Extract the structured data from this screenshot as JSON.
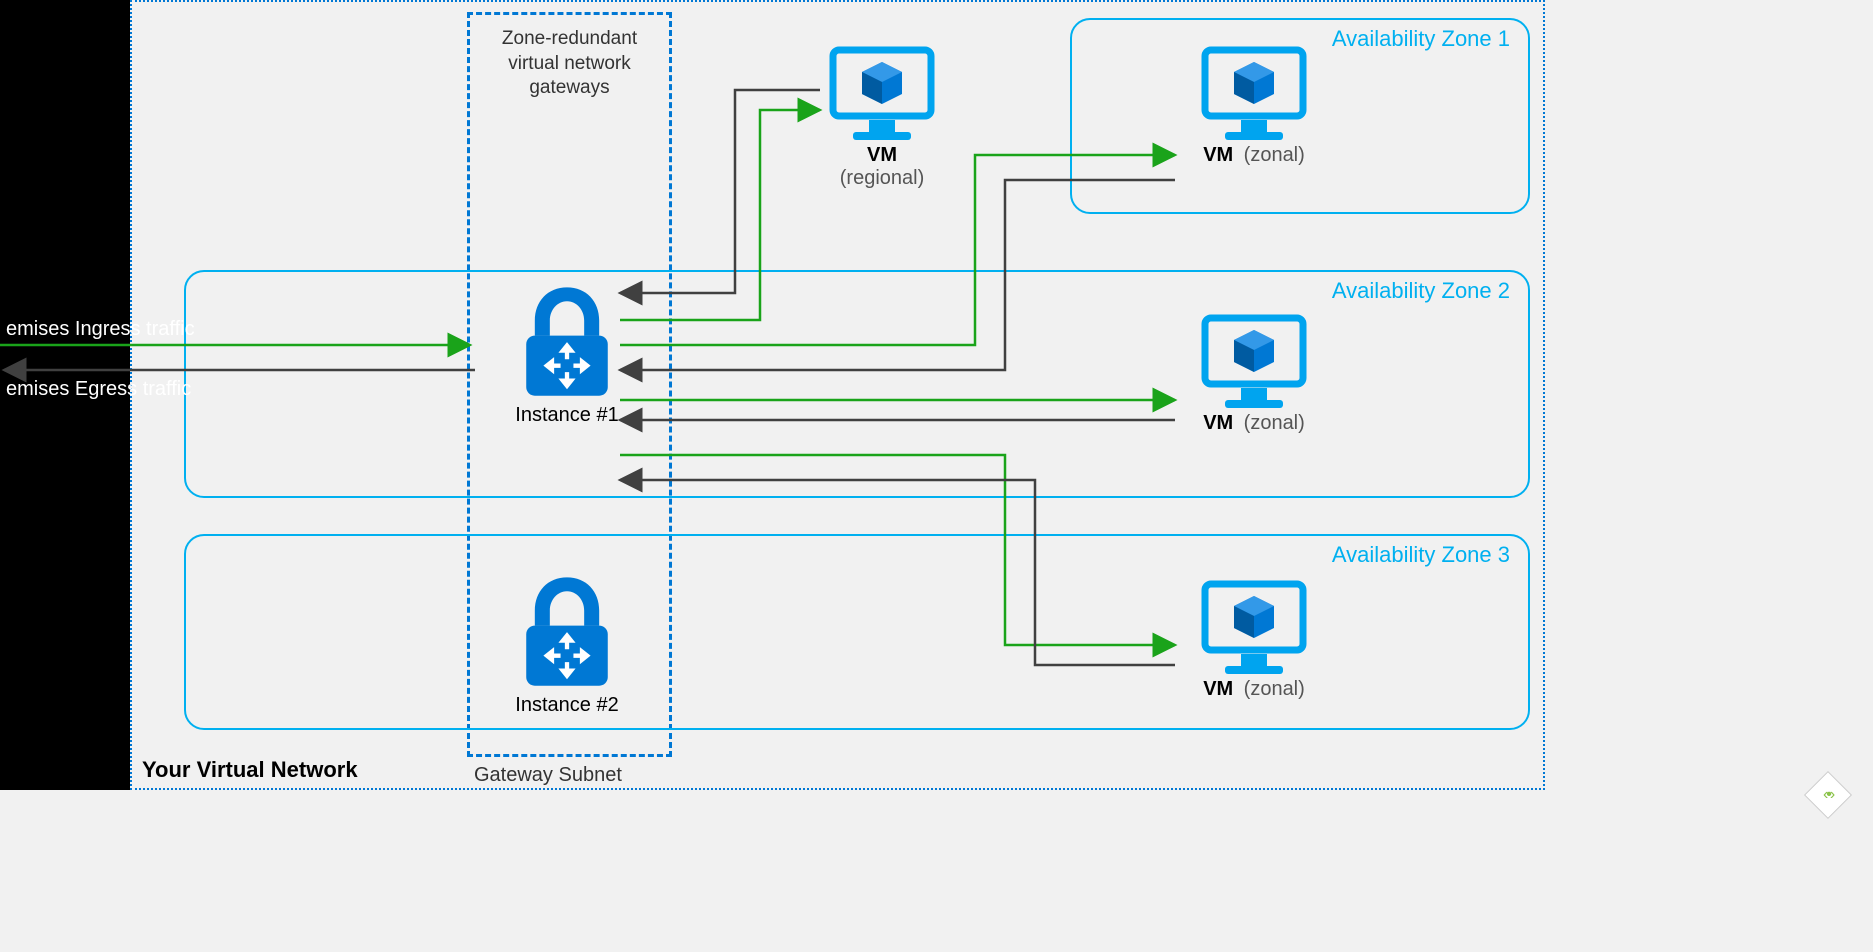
{
  "vnet": {
    "label": "Your Virtual Network"
  },
  "gateway_subnet": {
    "caption_line1": "Zone-redundant",
    "caption_line2": "virtual network",
    "caption_line3": "gateways",
    "label": "Gateway Subnet",
    "instances": [
      {
        "label": "Instance #1"
      },
      {
        "label": "Instance #2"
      }
    ]
  },
  "availability_zones": [
    {
      "label": "Availability Zone 1"
    },
    {
      "label": "Availability Zone 2"
    },
    {
      "label": "Availability Zone 3"
    }
  ],
  "vms": {
    "regional": {
      "name": "VM",
      "sub": "(regional)"
    },
    "zonal1": {
      "name": "VM",
      "sub": "(zonal)"
    },
    "zonal2": {
      "name": "VM",
      "sub": "(zonal)"
    },
    "zonal3": {
      "name": "VM",
      "sub": "(zonal)"
    }
  },
  "traffic": {
    "ingress": "emises Ingress traffic",
    "egress": "emises Egress traffic"
  },
  "colors": {
    "azure_blue": "#0078d4",
    "zone_blue": "#00b0f0",
    "green": "#1aa31a",
    "dark": "#404040"
  }
}
